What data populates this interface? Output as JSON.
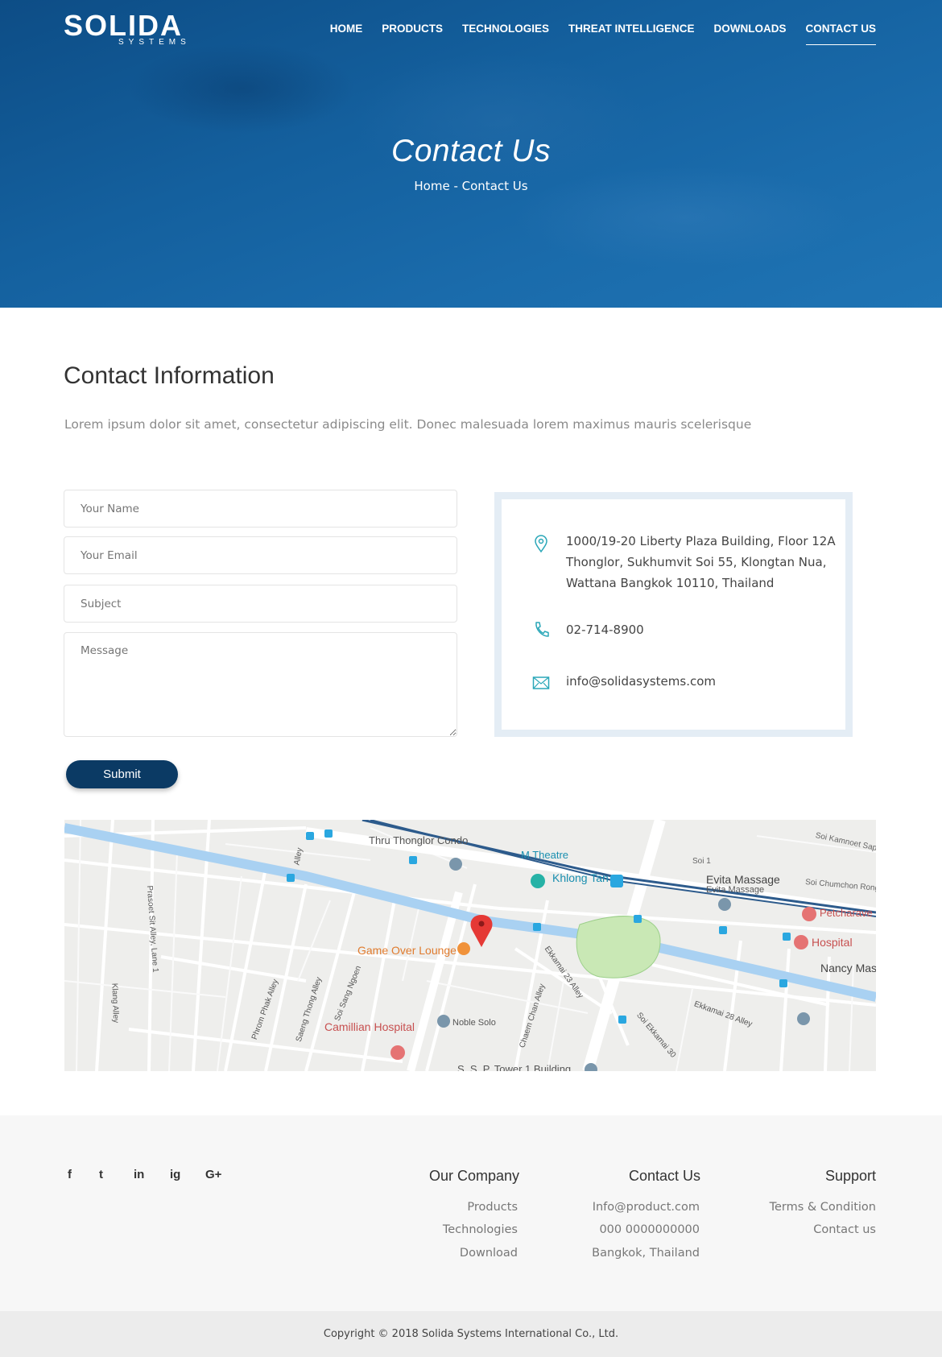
{
  "nav": {
    "logo_main": "SOLIDA",
    "logo_sub": "SYSTEMS",
    "items": [
      {
        "label": "HOME"
      },
      {
        "label": "PRODUCTS"
      },
      {
        "label": "TECHNOLOGIES"
      },
      {
        "label": "THREAT INTELLIGENCE"
      },
      {
        "label": "DOWNLOADS"
      },
      {
        "label": "CONTACT US",
        "active": true
      }
    ]
  },
  "hero": {
    "title": "Contact Us",
    "breadcrumb": "Home - Contact Us"
  },
  "contact": {
    "title": "Contact Information",
    "description": "Lorem ipsum dolor sit amet, consectetur adipiscing elit. Donec malesuada lorem maximus mauris scelerisque",
    "form": {
      "name_placeholder": "Your Name",
      "email_placeholder": "Your Email",
      "subject_placeholder": "Subject",
      "message_placeholder": "Message",
      "submit_label": "Submit"
    },
    "info": {
      "address_line1": "1000/19-20 Liberty Plaza Building, Floor 12A",
      "address_line2": "Thonglor, Sukhumvit Soi 55, Klongtan Nua,",
      "address_line3": "Wattana Bangkok 10110, Thailand",
      "phone": "02-714-8900",
      "email": "info@solidasystems.com",
      "icon_address": "location-pin-icon",
      "icon_phone": "phone-icon",
      "icon_email": "envelope-icon",
      "accent_color": "#2aa7b8"
    }
  },
  "map": {
    "labels": {
      "thru_thonglor": "Thru Thonglor Condo",
      "m_theatre": "M Theatre",
      "khlong_tan": "Khlong Tan",
      "evita": "Evita Massage",
      "evita_sub": "Evita Massage",
      "petcharavej": "Petcharave",
      "hospital": "Hospital",
      "game_over": "Game Over Lounge",
      "nancy": "Nancy Mas",
      "camillian": "Camillian Hospital",
      "noble_solo": "Noble Solo",
      "sp_tower": "S. S. P. Tower 1 Building",
      "soi1": "Soi 1",
      "soi_chumchon": "Soi Chumchon Rong",
      "soi_kamnoet": "Soi Kamnoet Sap",
      "ekkamai23": "Ekkamai 23 Alley",
      "ekkamai28": "Ekkamai 28 Alley",
      "ekkamai30": "Soi Ekkamai 30",
      "phrom_phak": "Phrom Phak Alley",
      "saeng_thong": "Saeng Thong Alley",
      "soi_sang": "Soi Sang Ngoen",
      "chaem_chan": "Chaem Chan Alley",
      "klang": "Klang Alley",
      "prasoet": "Prasoet Sit Alley, Lane 1",
      "alley": "Alley"
    },
    "water_color": "#a9d1f2",
    "park_color": "#c9e8b5",
    "marker_color": "#e53935"
  },
  "footer": {
    "social": [
      "f",
      "t",
      "in",
      "ig",
      "G+"
    ],
    "social_icons": [
      "facebook-icon",
      "twitter-icon",
      "linkedin-icon",
      "instagram-icon",
      "google-plus-icon"
    ],
    "company": {
      "title": "Our Company",
      "links": [
        "Products",
        "Technologies",
        "Download"
      ]
    },
    "contact": {
      "title": "Contact Us",
      "links": [
        "Info@product.com",
        "000 0000000000",
        "Bangkok, Thailand"
      ]
    },
    "support": {
      "title": "Support",
      "links": [
        "Terms & Condition",
        "Contact us"
      ]
    },
    "copyright": "Copyright © 2018 Solida Systems International Co., Ltd."
  }
}
